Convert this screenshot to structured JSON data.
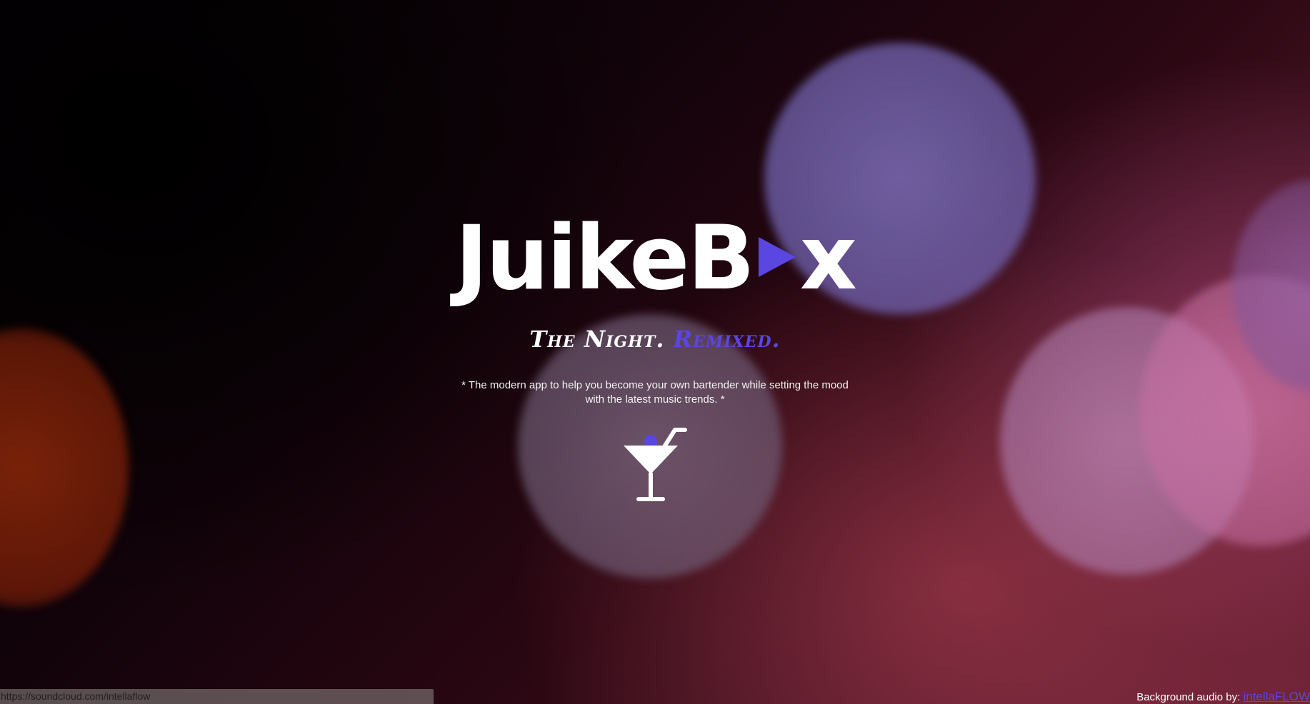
{
  "hero": {
    "logo_left": "JuikeB",
    "logo_right": "x",
    "tagline_main": "The Night.",
    "tagline_accent": "Remixed.",
    "description": "* The modern app to help you become your own bartender while setting the mood with the latest music trends. *"
  },
  "footer": {
    "status_url": "https://soundcloud.com/intellaflow",
    "credit_label": "Background audio by:",
    "credit_link": "intellaFLOW"
  },
  "icons": {
    "logo_o": "play-triangle-icon",
    "cta": "cocktail-glass-icon"
  },
  "colors": {
    "accent": "#5a46e0",
    "text": "#ffffff"
  }
}
